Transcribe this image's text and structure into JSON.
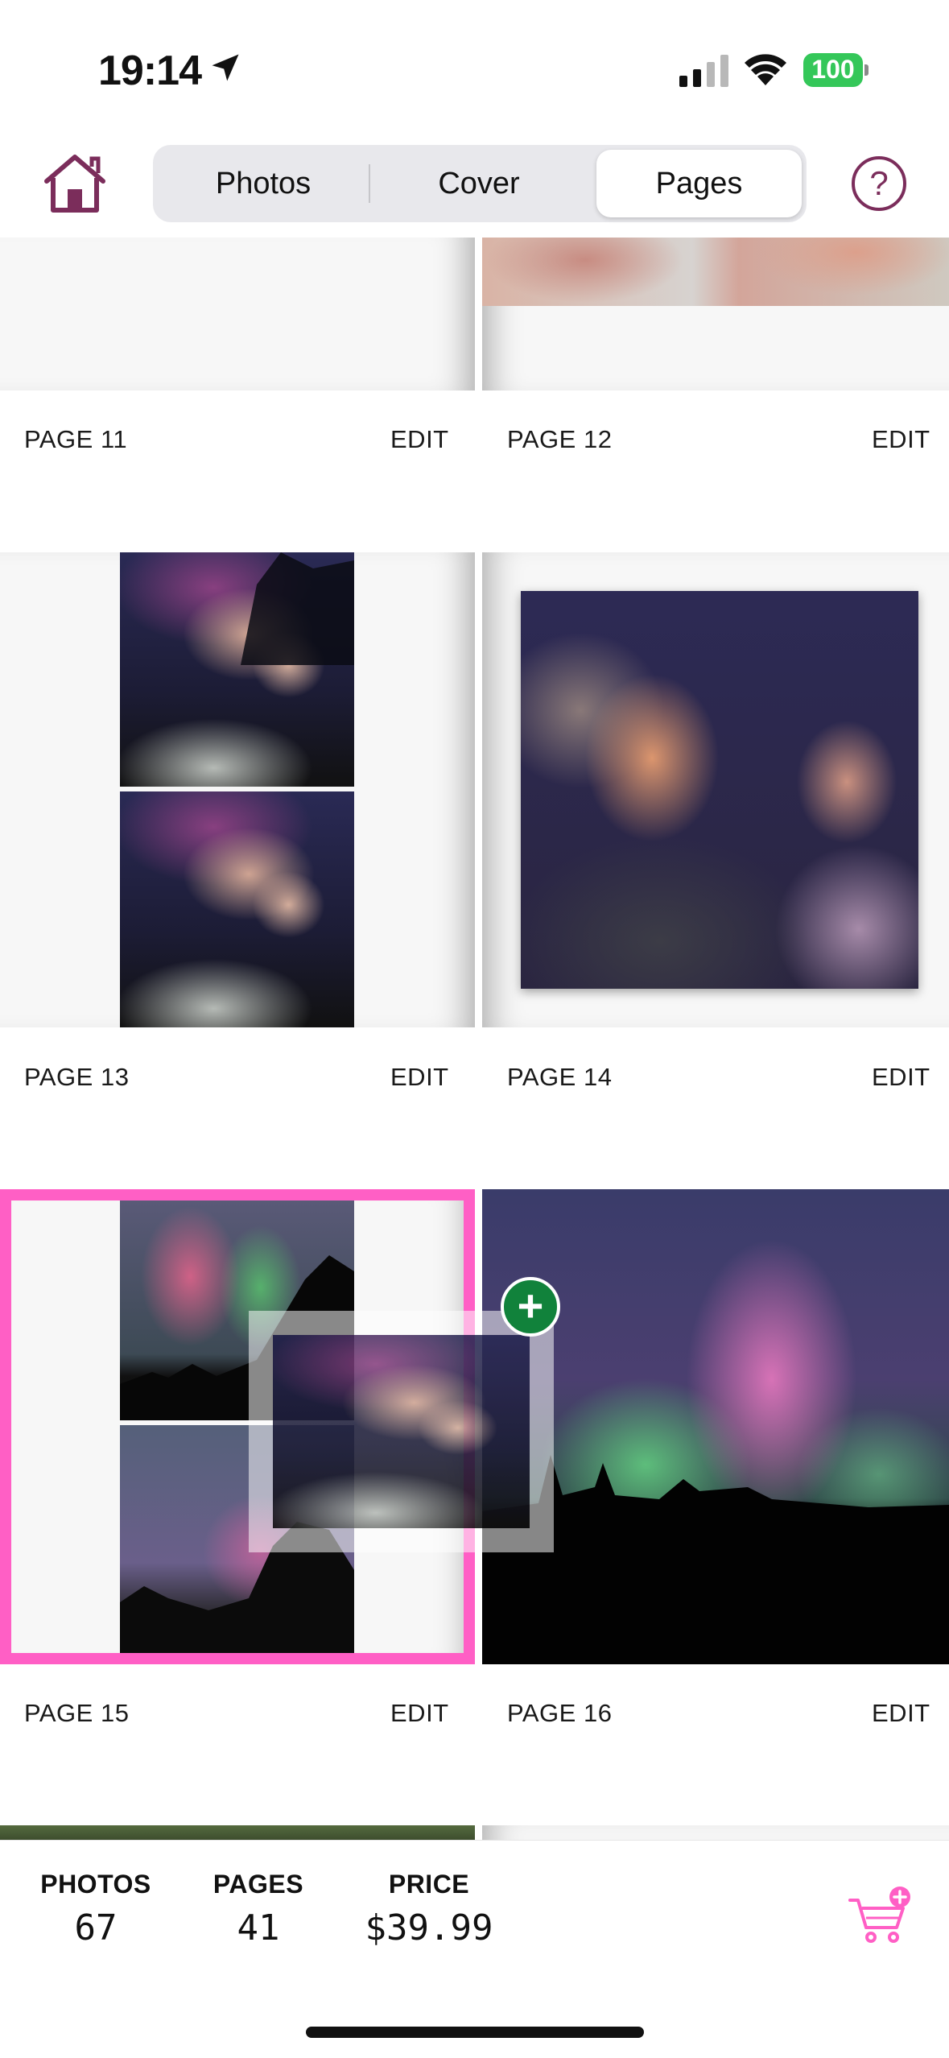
{
  "status_bar": {
    "time": "19:14",
    "battery": "100"
  },
  "nav": {
    "tabs": [
      {
        "label": "Photos",
        "selected": false
      },
      {
        "label": "Cover",
        "selected": false
      },
      {
        "label": "Pages",
        "selected": true
      }
    ],
    "help": "?"
  },
  "pages": [
    {
      "label": "PAGE 11",
      "edit": "EDIT"
    },
    {
      "label": "PAGE 12",
      "edit": "EDIT"
    },
    {
      "label": "PAGE 13",
      "edit": "EDIT"
    },
    {
      "label": "PAGE 14",
      "edit": "EDIT"
    },
    {
      "label": "PAGE 15",
      "edit": "EDIT"
    },
    {
      "label": "PAGE 16",
      "edit": "EDIT"
    }
  ],
  "drag": {
    "badge": "+"
  },
  "summary": {
    "photos_label": "PHOTOS",
    "photos_value": "67",
    "pages_label": "PAGES",
    "pages_value": "41",
    "price_label": "PRICE",
    "price_value": "$39.99"
  },
  "colors": {
    "brand": "#7b2d5b",
    "drop_highlight": "#ff5fc5",
    "add_badge": "#11823b",
    "cart": "#ff5fc5",
    "battery": "#34c759"
  },
  "icons": {
    "location": "location-arrow-icon",
    "signal": "cellular-signal-icon",
    "wifi": "wifi-icon",
    "home": "home-icon",
    "help": "question-mark-icon",
    "cart": "cart-add-icon"
  }
}
